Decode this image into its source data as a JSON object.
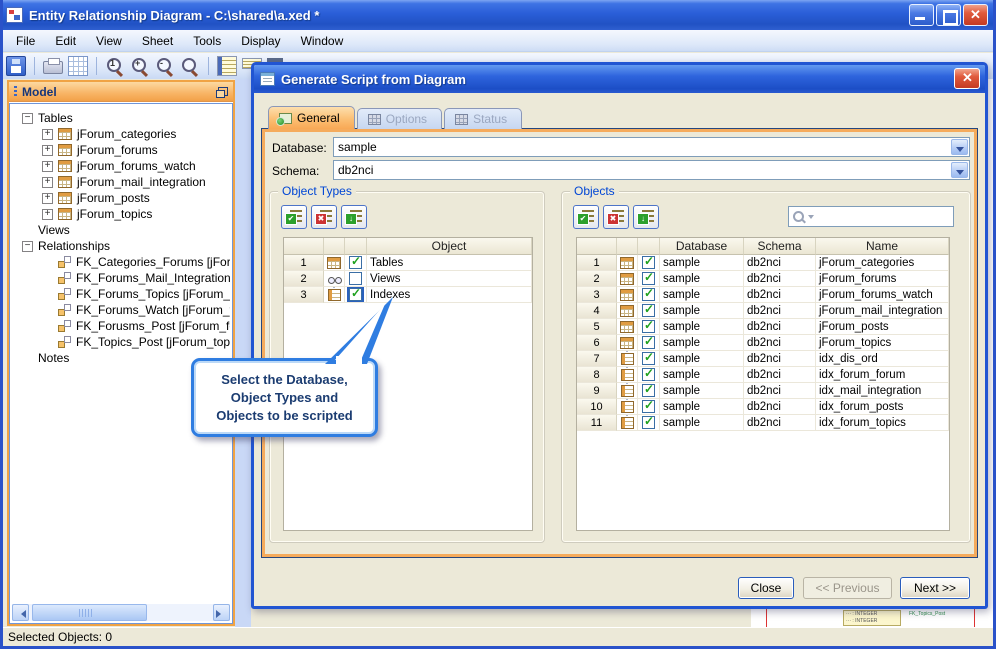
{
  "window": {
    "title": "Entity Relationship Diagram - C:\\shared\\a.xed *",
    "control_icons": [
      "minimize-icon",
      "maximize-icon",
      "close-icon"
    ],
    "status_bar": "Selected Objects: 0"
  },
  "menu_bar": {
    "items": [
      "File",
      "Edit",
      "View",
      "Sheet",
      "Tools",
      "Display",
      "Window"
    ]
  },
  "toolbar_icons": [
    "save-icon",
    "print-icon",
    "grid-icon",
    "zoom-actual-icon",
    "zoom-in-icon",
    "zoom-out-icon",
    "zoom-icon",
    "panel-list-icon",
    "panel-form-icon",
    "panel-collapse-icon"
  ],
  "zoom_glyphs": {
    "actual": "1",
    "in": "+",
    "out": "-"
  },
  "model_panel": {
    "title": "Model",
    "tree": [
      {
        "label": "Tables",
        "lv": "lv0",
        "tg": "tg-minus",
        "ic": "no-icon"
      },
      {
        "label": "jForum_categories",
        "lv": "lv1",
        "tg": "tg-plus",
        "ic": "table-icon"
      },
      {
        "label": "jForum_forums",
        "lv": "lv1",
        "tg": "tg-plus",
        "ic": "table-icon"
      },
      {
        "label": "jForum_forums_watch",
        "lv": "lv1",
        "tg": "tg-plus",
        "ic": "table-icon"
      },
      {
        "label": "jForum_mail_integration",
        "lv": "lv1",
        "tg": "tg-plus",
        "ic": "table-icon"
      },
      {
        "label": "jForum_posts",
        "lv": "lv1",
        "tg": "tg-plus",
        "ic": "table-icon"
      },
      {
        "label": "jForum_topics",
        "lv": "lv1",
        "tg": "tg-plus",
        "ic": "table-icon"
      },
      {
        "label": "Views",
        "lv": "lv0",
        "tg": "tg-none",
        "ic": "no-icon"
      },
      {
        "label": "Relationships",
        "lv": "lv0",
        "tg": "tg-minus",
        "ic": "no-icon"
      },
      {
        "label": "FK_Categories_Forums [jForum_ca",
        "lv": "lv1",
        "tg": "tg-none",
        "ic": "relationship-icon"
      },
      {
        "label": "FK_Forums_Mail_Integration [jForu",
        "lv": "lv1",
        "tg": "tg-none",
        "ic": "relationship-icon"
      },
      {
        "label": "FK_Forums_Topics [jForum_forums",
        "lv": "lv1",
        "tg": "tg-none",
        "ic": "relationship-icon"
      },
      {
        "label": "FK_Forums_Watch [jForum_forums",
        "lv": "lv1",
        "tg": "tg-none",
        "ic": "relationship-icon"
      },
      {
        "label": "FK_Forusms_Post [jForum_forums",
        "lv": "lv1",
        "tg": "tg-none",
        "ic": "relationship-icon"
      },
      {
        "label": "FK_Topics_Post [jForum_topics - jF",
        "lv": "lv1",
        "tg": "tg-none",
        "ic": "relationship-icon"
      },
      {
        "label": "Notes",
        "lv": "lv0",
        "tg": "tg-none",
        "ic": "no-icon"
      }
    ]
  },
  "dialog": {
    "title": "Generate Script from Diagram",
    "close_icon": "close-icon",
    "tabs": [
      {
        "label": "General",
        "state": "active"
      },
      {
        "label": "Options",
        "state": "disabled"
      },
      {
        "label": "Status",
        "state": "disabled"
      }
    ],
    "database_label": "Database:",
    "database_value": "sample",
    "schema_label": "Schema:",
    "schema_value": "db2nci",
    "object_types": {
      "caption": "Object Types",
      "toolbar_icons": [
        "check-all-icon",
        "uncheck-all-icon",
        "invert-check-icon"
      ],
      "object_column": "Object",
      "rows": [
        {
          "num": "1",
          "ic": "table-icon",
          "checked": true,
          "focus": "",
          "label": "Tables"
        },
        {
          "num": "2",
          "ic": "glasses-icon",
          "checked": false,
          "focus": "",
          "label": "Views"
        },
        {
          "num": "3",
          "ic": "index-icon",
          "checked": true,
          "focus": "focus",
          "label": "Indexes"
        }
      ]
    },
    "objects": {
      "caption": "Objects",
      "toolbar_icons": [
        "check-all-icon",
        "uncheck-all-icon",
        "invert-check-icon"
      ],
      "search_value": "",
      "columns": {
        "database": "Database",
        "schema": "Schema",
        "name": "Name"
      },
      "rows": [
        {
          "num": "1",
          "ic": "table-icon",
          "checked": true,
          "database": "sample",
          "schema": "db2nci",
          "name": "jForum_categories"
        },
        {
          "num": "2",
          "ic": "table-icon",
          "checked": true,
          "database": "sample",
          "schema": "db2nci",
          "name": "jForum_forums"
        },
        {
          "num": "3",
          "ic": "table-icon",
          "checked": true,
          "database": "sample",
          "schema": "db2nci",
          "name": "jForum_forums_watch"
        },
        {
          "num": "4",
          "ic": "table-icon",
          "checked": true,
          "database": "sample",
          "schema": "db2nci",
          "name": "jForum_mail_integration"
        },
        {
          "num": "5",
          "ic": "table-icon",
          "checked": true,
          "database": "sample",
          "schema": "db2nci",
          "name": "jForum_posts"
        },
        {
          "num": "6",
          "ic": "table-icon",
          "checked": true,
          "database": "sample",
          "schema": "db2nci",
          "name": "jForum_topics"
        },
        {
          "num": "7",
          "ic": "index-icon",
          "checked": true,
          "database": "sample",
          "schema": "db2nci",
          "name": "idx_dis_ord"
        },
        {
          "num": "8",
          "ic": "index-icon",
          "checked": true,
          "database": "sample",
          "schema": "db2nci",
          "name": "idx_forum_forum"
        },
        {
          "num": "9",
          "ic": "index-icon",
          "checked": true,
          "database": "sample",
          "schema": "db2nci",
          "name": "idx_mail_integration"
        },
        {
          "num": "10",
          "ic": "index-icon",
          "checked": true,
          "database": "sample",
          "schema": "db2nci",
          "name": "idx_forum_posts"
        },
        {
          "num": "11",
          "ic": "index-icon",
          "checked": true,
          "database": "sample",
          "schema": "db2nci",
          "name": "idx_forum_topics"
        }
      ]
    },
    "buttons": {
      "close": "Close",
      "previous": "<< Previous",
      "next": "Next >>"
    }
  },
  "callout": {
    "lines": [
      "Select the Database,",
      "Object Types and",
      "Objects to be scripted"
    ]
  },
  "canvas_fragment": {
    "entity_attr_1": "··· : INTEGER",
    "entity_attr_2": "··· : INTEGER",
    "relationship_label": "FK_Topics_Post"
  }
}
